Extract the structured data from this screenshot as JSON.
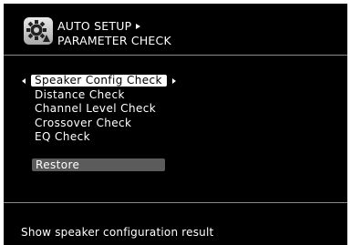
{
  "header": {
    "icon": "gear-icon",
    "title_line1": "AUTO SETUP",
    "title_line2": "PARAMETER CHECK"
  },
  "menu": {
    "items": [
      {
        "label": "Speaker Config Check",
        "selected": true
      },
      {
        "label": "Distance Check",
        "selected": false
      },
      {
        "label": "Channel Level Check",
        "selected": false
      },
      {
        "label": "Crossover Check",
        "selected": false
      },
      {
        "label": "EQ Check",
        "selected": false
      }
    ],
    "restore_label": "Restore"
  },
  "help_text": "Show speaker configuration result",
  "colors": {
    "background": "#000000",
    "text": "#ffffff",
    "highlight": "#ffffff",
    "highlight_text": "#000000",
    "restore_bg": "#5b5b5b",
    "divider": "#8a8a8a"
  }
}
